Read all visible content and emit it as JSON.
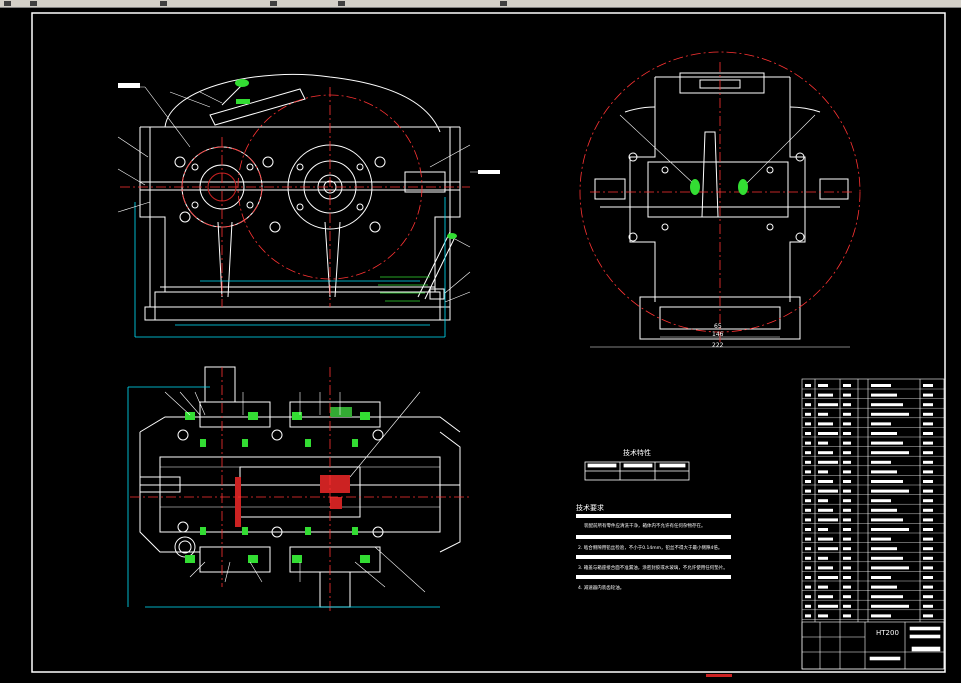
{
  "toolbar": {
    "label": ""
  },
  "drawing": {
    "title_block_code": "HT200",
    "tech_characteristics_title": "技术特性",
    "tech_requirements_title": "技术要求",
    "tech_requirements": [
      "装配前所有零件应清洗干净，箱体内不允许有任何杂物存在。",
      "2. 啮合侧隙用铅丝检验，不小于0.14mm，铅丝不得大于最小侧隙4倍。",
      "3. 箱盖与箱座接合面不准漏油，涂密封胶或水玻璃，不允许使用任何垫片。",
      "4. 减速器内装齿轮油。"
    ],
    "dims": {
      "side_width": "222",
      "side_inner": "146",
      "side_inner2": "65"
    }
  },
  "colors": {
    "background": "#000000",
    "line": "#ffffff",
    "center": "#ff3333",
    "dim": "#00e5ff",
    "accent": "#33dd33",
    "red_part": "#cc2222",
    "leader": "#ffffff"
  }
}
